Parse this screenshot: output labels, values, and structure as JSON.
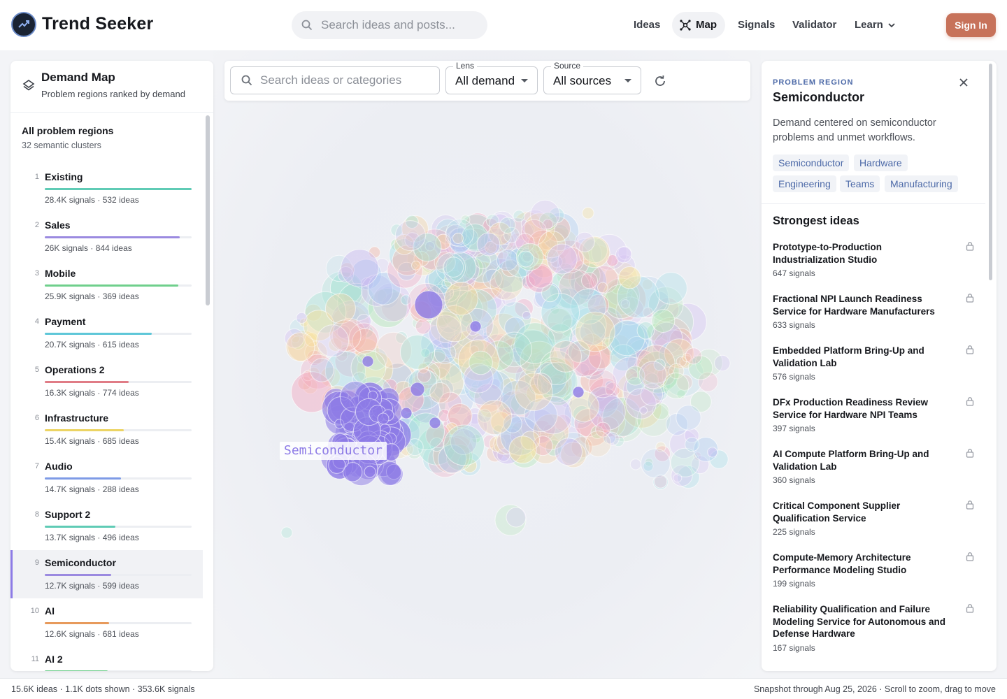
{
  "app": {
    "brand": "Trend Seeker"
  },
  "header": {
    "search_placeholder": "Search ideas and posts...",
    "nav": {
      "ideas": "Ideas",
      "map": "Map",
      "signals": "Signals",
      "validator": "Validator",
      "learn": "Learn"
    },
    "sign_in": "Sign In"
  },
  "left_panel": {
    "title": "Demand Map",
    "subtitle": "Problem regions ranked by demand",
    "all_title": "All problem regions",
    "all_sub": "32 semantic clusters",
    "regions": [
      {
        "rank": "1",
        "name": "Existing",
        "meta": "28.4K signals · 532 ideas",
        "share": 1.0,
        "color": "#5fcbb5"
      },
      {
        "rank": "2",
        "name": "Sales",
        "meta": "26K signals · 844 ideas",
        "share": 0.92,
        "color": "#9b8ae0"
      },
      {
        "rank": "3",
        "name": "Mobile",
        "meta": "25.9K signals · 369 ideas",
        "share": 0.91,
        "color": "#6fcf8c"
      },
      {
        "rank": "4",
        "name": "Payment",
        "meta": "20.7K signals · 615 ideas",
        "share": 0.73,
        "color": "#5ec7d8"
      },
      {
        "rank": "5",
        "name": "Operations 2",
        "meta": "16.3K signals · 774 ideas",
        "share": 0.57,
        "color": "#e07c86"
      },
      {
        "rank": "6",
        "name": "Infrastructure",
        "meta": "15.4K signals · 685 ideas",
        "share": 0.54,
        "color": "#ecd463"
      },
      {
        "rank": "7",
        "name": "Audio",
        "meta": "14.7K signals · 288 ideas",
        "share": 0.52,
        "color": "#7e9be6"
      },
      {
        "rank": "8",
        "name": "Support 2",
        "meta": "13.7K signals · 496 ideas",
        "share": 0.48,
        "color": "#5fcbb5"
      },
      {
        "rank": "9",
        "name": "Semiconductor",
        "meta": "12.7K signals · 599 ideas",
        "share": 0.45,
        "color": "#9b8ae0",
        "active": true
      },
      {
        "rank": "10",
        "name": "AI",
        "meta": "12.6K signals · 681 ideas",
        "share": 0.44,
        "color": "#e79a5c"
      },
      {
        "rank": "11",
        "name": "AI 2",
        "meta": "",
        "share": 0.43,
        "color": "#6fcf8c"
      }
    ]
  },
  "toolbar": {
    "search_placeholder": "Search ideas or categories",
    "lens_label": "Lens",
    "lens_value": "All demand",
    "source_label": "Source",
    "source_value": "All sources"
  },
  "map": {
    "highlight_label": "Semiconductor",
    "palette": [
      "#f3a6c1",
      "#a8e0e8",
      "#b5e8b8",
      "#c9b8f0",
      "#f6d5a3",
      "#a9c9f2",
      "#f4b8a8",
      "#d6c3f4",
      "#9fe3d2",
      "#f9e39b"
    ],
    "highlight_color": "#8d7be6"
  },
  "right_panel": {
    "kicker": "PROBLEM REGION",
    "title": "Semiconductor",
    "description": "Demand centered on semiconductor problems and unmet workflows.",
    "tags": [
      "Semiconductor",
      "Hardware",
      "Engineering",
      "Teams",
      "Manufacturing"
    ],
    "strongest_title": "Strongest ideas",
    "ideas": [
      {
        "title": "Prototype-to-Production Industrialization Studio",
        "signals": "647 signals"
      },
      {
        "title": "Fractional NPI Launch Readiness Service for Hardware Manufacturers",
        "signals": "633 signals"
      },
      {
        "title": "Embedded Platform Bring-Up and Validation Lab",
        "signals": "576 signals"
      },
      {
        "title": "DFx Production Readiness Review Service for Hardware NPI Teams",
        "signals": "397 signals"
      },
      {
        "title": "AI Compute Platform Bring-Up and Validation Lab",
        "signals": "360 signals"
      },
      {
        "title": "Critical Component Supplier Qualification Service",
        "signals": "225 signals"
      },
      {
        "title": "Compute-Memory Architecture Performance Modeling Studio",
        "signals": "199 signals"
      },
      {
        "title": "Reliability Qualification and Failure Modeling Service for Autonomous and Defense Hardware",
        "signals": "167 signals"
      }
    ]
  },
  "footer": {
    "left": "15.6K ideas · 1.1K dots shown · 353.6K signals",
    "right": "Snapshot through Aug 25, 2026 · Scroll to zoom, drag to move"
  }
}
